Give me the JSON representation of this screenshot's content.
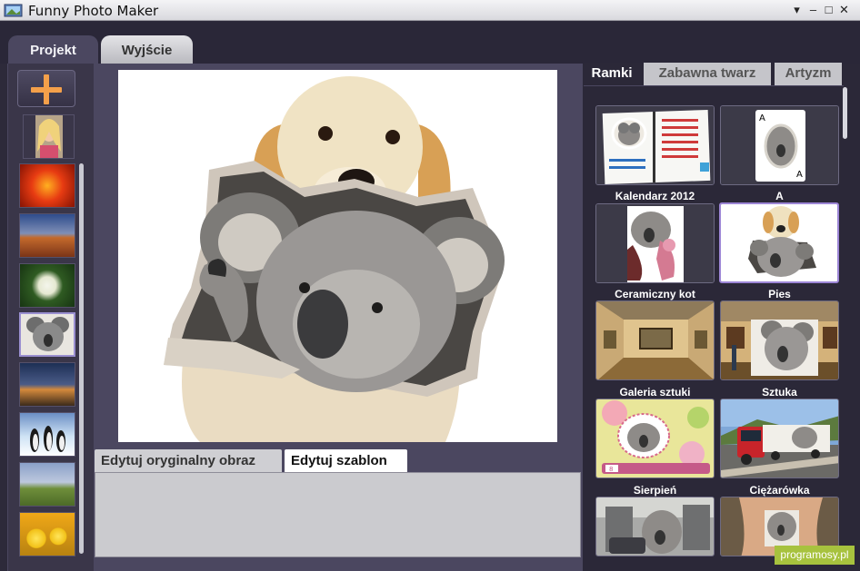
{
  "window": {
    "title": "Funny Photo Maker",
    "controls": {
      "menu": "▾",
      "minimize": "–",
      "maximize": "□",
      "close": "✕"
    }
  },
  "main_tabs": [
    {
      "label": "Projekt",
      "active": true
    },
    {
      "label": "Wyjście",
      "active": false
    }
  ],
  "left_panel": {
    "add_icon": "plus-icon",
    "thumbnails": [
      {
        "name": "portrait-woman"
      },
      {
        "name": "red-flower"
      },
      {
        "name": "canyon-sunset"
      },
      {
        "name": "white-flowers"
      },
      {
        "name": "koala",
        "selected": true
      },
      {
        "name": "temple-dusk"
      },
      {
        "name": "penguins"
      },
      {
        "name": "meadow"
      },
      {
        "name": "yellow-tulips"
      }
    ]
  },
  "edit_tabs": [
    {
      "label": "Edytuj oryginalny obraz",
      "active": false
    },
    {
      "label": "Edytuj szablon",
      "active": true
    }
  ],
  "right_tabs": [
    {
      "label": "Ramki",
      "active": true
    },
    {
      "label": "Zabawna twarz",
      "active": false
    },
    {
      "label": "Artyzm",
      "active": false
    }
  ],
  "frames": [
    {
      "label": "Kalendarz 2012"
    },
    {
      "label": "A"
    },
    {
      "label": "Ceramiczny kot"
    },
    {
      "label": "Pies",
      "selected": true
    },
    {
      "label": "Galeria sztuki"
    },
    {
      "label": "Sztuka"
    },
    {
      "label": "Sierpień"
    },
    {
      "label": "Ciężarówka"
    },
    {
      "label": ""
    },
    {
      "label": ""
    }
  ],
  "calendar_date": "8",
  "watermark": "programosy.pl",
  "colors": {
    "panel": "#4b4760",
    "dark": "#2b2838",
    "selection": "#9d86d6",
    "watermark": "#a7c23e"
  }
}
